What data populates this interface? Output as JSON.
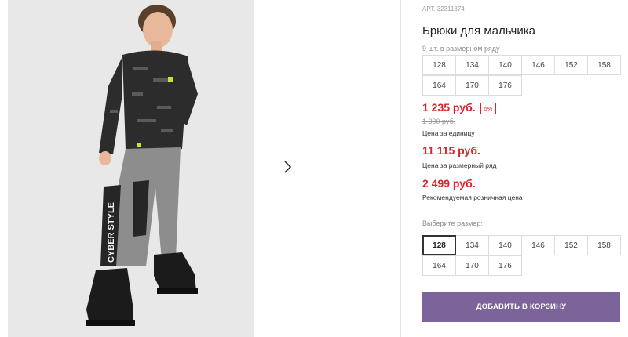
{
  "product": {
    "sku": "АРТ. 32311374",
    "title": "Брюки для мальчика"
  },
  "pack": {
    "caption": "9 шт. в размерном ряду",
    "rows": [
      [
        "128",
        "134",
        "140",
        "146",
        "152",
        "158"
      ],
      [
        "164",
        "170",
        "176"
      ]
    ]
  },
  "pricing": {
    "price": "1 235 руб.",
    "discount": "5%",
    "old_price": "1 300 руб.",
    "unit_label": "Цена за единицу",
    "pack_price": "11 115 руб.",
    "pack_label": "Цена за размерный ряд",
    "retail_price": "2 499 руб.",
    "retail_label": "Рекомендуемая розничная цена"
  },
  "size_select": {
    "caption": "Выберите размер:",
    "selected": "128",
    "rows": [
      [
        "128",
        "134",
        "140",
        "146",
        "152",
        "158"
      ],
      [
        "164",
        "170",
        "176"
      ]
    ]
  },
  "cart": {
    "button_label": "ДОБАВИТЬ В КОРЗИНУ"
  },
  "gallery": {
    "next_icon": "chevron-right-icon",
    "photo": {
      "print_text": "CYBER STYLE"
    }
  },
  "colors": {
    "price_red": "#d8232a",
    "button_purple": "#7c6399"
  }
}
